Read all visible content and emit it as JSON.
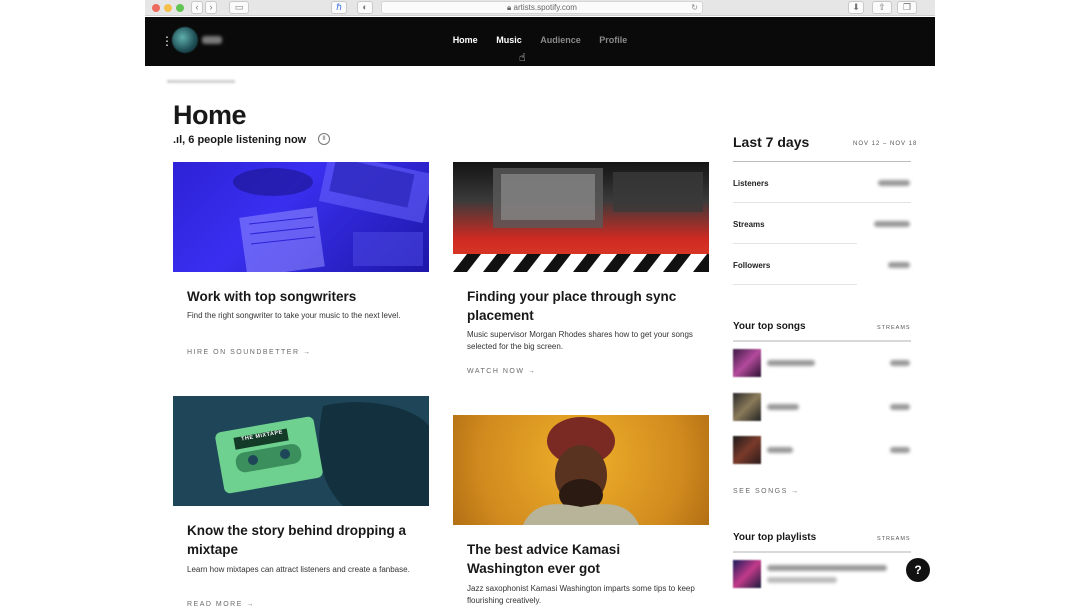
{
  "browser": {
    "url": "artists.spotify.com",
    "back_icon": "chevron-left-icon",
    "forward_icon": "chevron-right-icon"
  },
  "nav": {
    "links": [
      "Home",
      "Music",
      "Audience",
      "Profile"
    ]
  },
  "home": {
    "title": "Home",
    "listening": ".ıl, 6 people listening now",
    "pause_symbol": "II"
  },
  "cards": [
    {
      "title": "Work with top songwriters",
      "desc": "Find the right songwriter to take your music to the next level.",
      "link": "HIRE ON SOUNDBETTER →"
    },
    {
      "title": "Finding your place through sync placement",
      "desc": "Music supervisor Morgan Rhodes shares how to get your songs selected for the big screen.",
      "link": "WATCH NOW →"
    },
    {
      "title": "Know the story behind dropping a mixtape",
      "desc": "Learn how mixtapes can attract listeners and create a fanbase.",
      "link": "READ MORE →",
      "image_text": "THE MIXTAPE"
    },
    {
      "title": "The best advice Kamasi Washington ever got",
      "desc": "Jazz saxophonist Kamasi Washington imparts some tips to keep flourishing creatively."
    }
  ],
  "sidebar": {
    "heading": "Last 7 days",
    "range": "NOV 12 – NOV 18",
    "stats": [
      "Listeners",
      "Streams",
      "Followers"
    ],
    "top_songs_title": "Your top songs",
    "streams_label": "STREAMS",
    "see_songs": "SEE SONGS →",
    "top_playlists_title": "Your top playlists",
    "help_symbol": "?"
  },
  "colors": {
    "nav_bg": "#0a0a0a",
    "accent_blue": "#3a2ff0",
    "accent_red": "#e2412a",
    "accent_teal": "#1e4658",
    "mixtape_green": "#6fd18f"
  }
}
